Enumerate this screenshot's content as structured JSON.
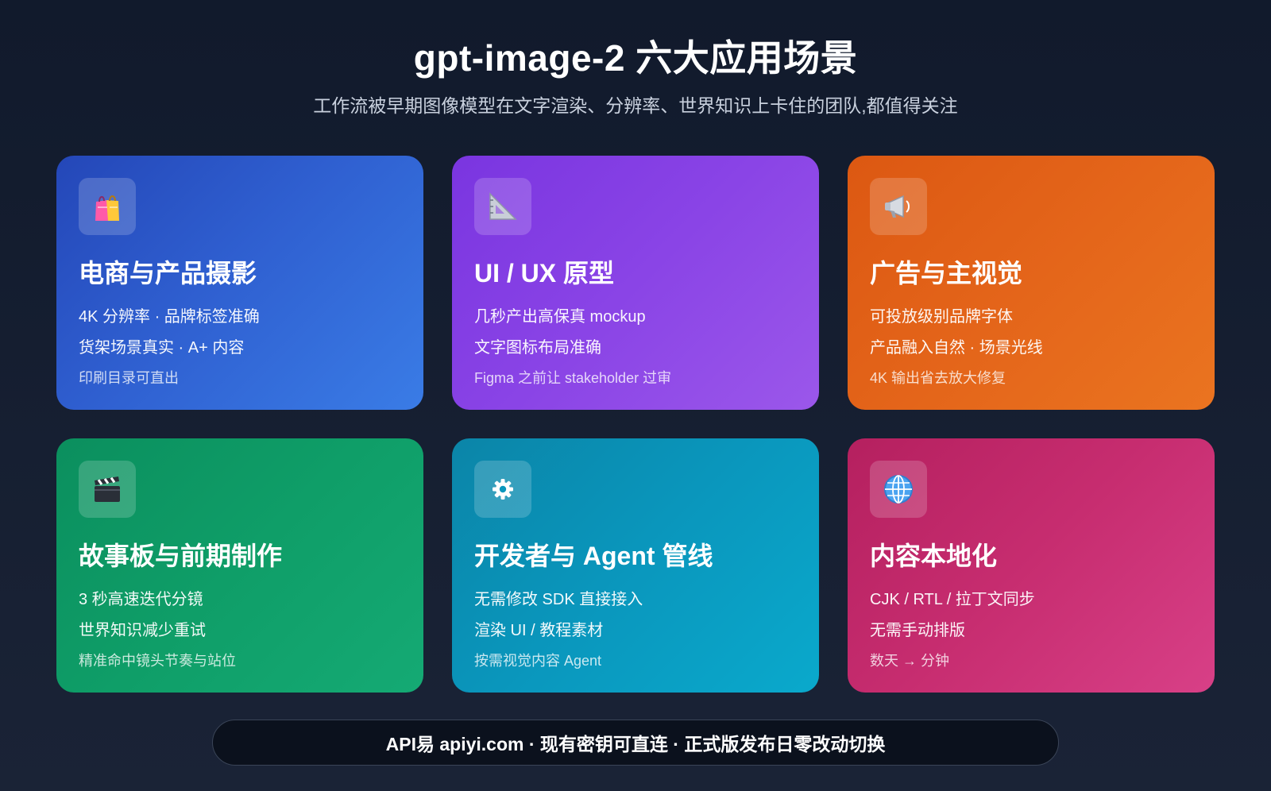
{
  "header": {
    "title": "gpt-image-2 六大应用场景",
    "subtitle": "工作流被早期图像模型在文字渲染、分辨率、世界知识上卡住的团队,都值得关注"
  },
  "cards": [
    {
      "icon": "shopping-bags-icon",
      "title": "电商与产品摄影",
      "line1": "4K 分辨率 · 品牌标签准确",
      "line2": "货架场景真实 · A+ 内容",
      "line3": "印刷目录可直出"
    },
    {
      "icon": "triangle-ruler-icon",
      "title": "UI / UX 原型",
      "line1": "几秒产出高保真 mockup",
      "line2": "文字图标布局准确",
      "line3": "Figma 之前让 stakeholder 过审"
    },
    {
      "icon": "megaphone-icon",
      "title": "广告与主视觉",
      "line1": "可投放级别品牌字体",
      "line2": "产品融入自然 · 场景光线",
      "line3": "4K 输出省去放大修复"
    },
    {
      "icon": "clapperboard-icon",
      "title": "故事板与前期制作",
      "line1": "3 秒高速迭代分镜",
      "line2": "世界知识减少重试",
      "line3": "精准命中镜头节奏与站位"
    },
    {
      "icon": "gear-icon",
      "title": "开发者与 Agent 管线",
      "line1": "无需修改 SDK 直接接入",
      "line2": "渲染 UI / 教程素材",
      "line3": "按需视觉内容 Agent"
    },
    {
      "icon": "globe-icon",
      "title": "内容本地化",
      "line1": "CJK / RTL / 拉丁文同步",
      "line2": "无需手动排版",
      "line3": "数天 → 分钟"
    }
  ],
  "footer": {
    "text": "API易 apiyi.com · 现有密钥可直连 · 正式版发布日零改动切换"
  }
}
